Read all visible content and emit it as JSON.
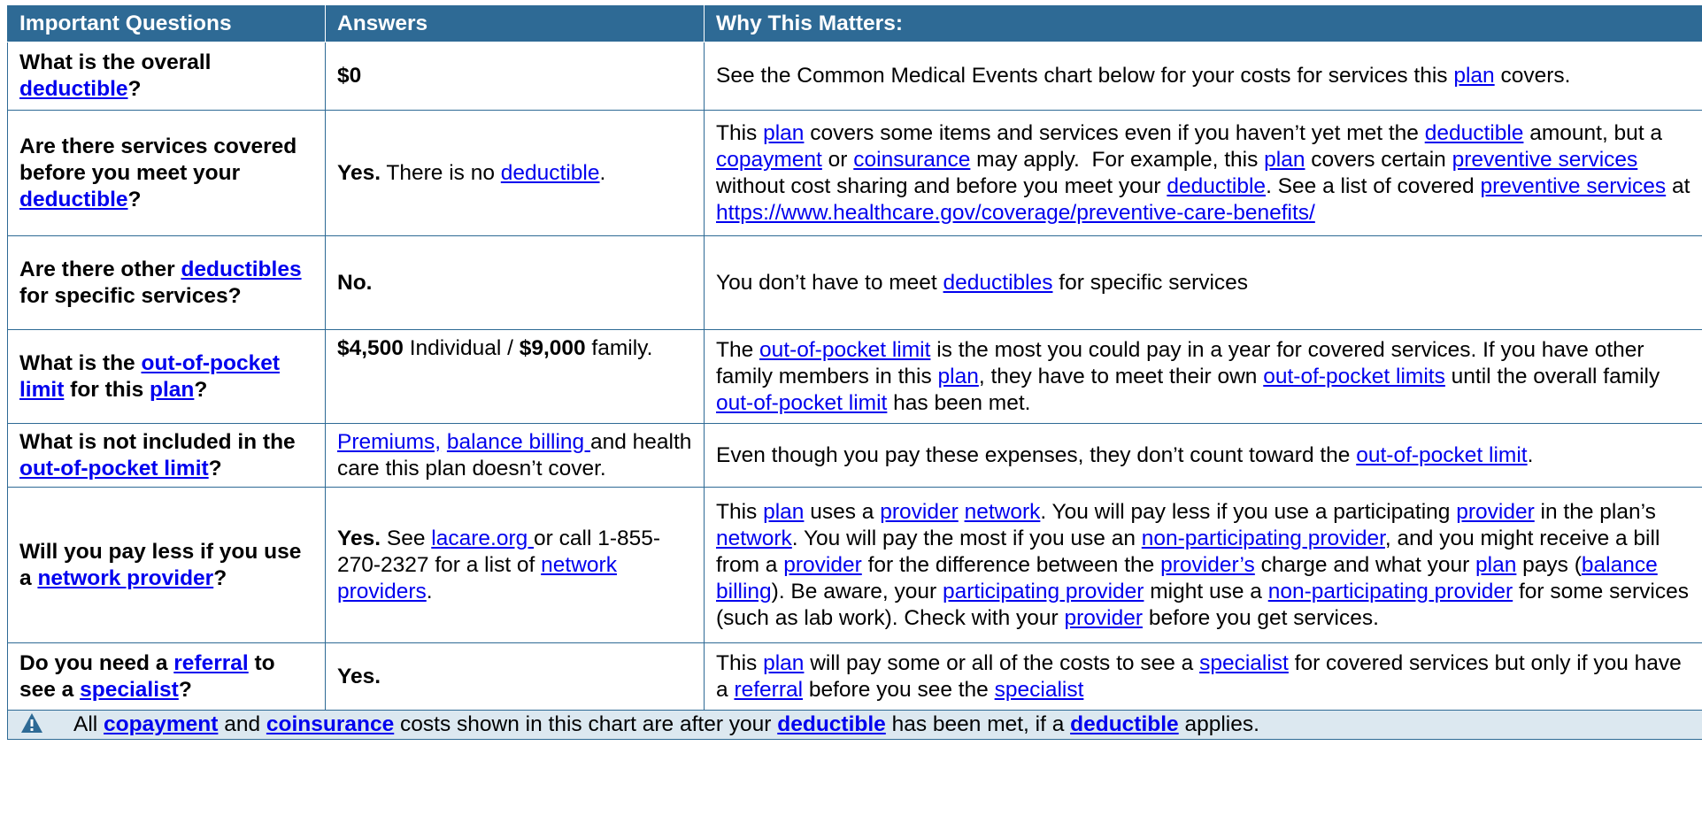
{
  "headers": {
    "questions": "Important Questions",
    "answers": "Answers",
    "why": "Why This Matters:"
  },
  "rows": {
    "r1": {
      "q_pre": "What is the overall ",
      "q_link": "deductible",
      "q_post": "?",
      "answer": "$0",
      "why_pre": "See the Common Medical Events chart below for your costs for services this ",
      "why_link": "plan",
      "why_post": " covers."
    },
    "r2": {
      "q_pre": "Are there services covered before you meet your ",
      "q_link": "deductible",
      "q_post": "?",
      "a_bold": "Yes.",
      "a_text": " There is no ",
      "a_link": "deductible",
      "a_post": ".",
      "w1": "This ",
      "w_plan": "plan",
      "w2": " covers some items and services even if you haven’t yet met the ",
      "w_deductible": "deductible",
      "w3": " amount, but a ",
      "w_copayment": "copayment",
      "w4": " or ",
      "w_coinsurance": "coinsurance",
      "w5": " may apply.  For example, this ",
      "w_plan2": "plan",
      "w6": " covers certain ",
      "w_preventive": "preventive services",
      "w7": " without cost sharing and before you meet your ",
      "w_deductible2": "deductible",
      "w8": ". See a list of covered ",
      "w_preventive2": "preventive services",
      "w9": " at ",
      "w_url": "https://www.healthcare.gov/coverage/preventive-care-benefits/"
    },
    "r3": {
      "q_pre": "Are there other ",
      "q_link": "deductibles",
      "q_post": " for specific services?",
      "answer": "No.",
      "why_pre": "You don’t have to meet ",
      "why_link": "deductibles",
      "why_post": " for specific services"
    },
    "r4": {
      "q_pre": "What is the ",
      "q_link": "out-of-pocket limit",
      "q_mid": " for this ",
      "q_link2": "plan",
      "q_post": "?",
      "a_b1": "$4,500",
      "a_t1": " Individual / ",
      "a_b2": "$9,000",
      "a_t2": " family.",
      "w1": "The ",
      "w_oop": "out-of-pocket limit",
      "w2": " is the most you could pay in a year for covered services. If you have other family members in this ",
      "w_plan": "plan",
      "w3": ", they have to meet their own ",
      "w_oops": "out-of-pocket limits",
      "w4": " until the overall family ",
      "w_oop2": "out-of-pocket limit",
      "w5": " has been met."
    },
    "r5": {
      "q_pre": "What is not included in the ",
      "q_link": "out-of-pocket limit",
      "q_post": "?",
      "a_link1": "Premiums,",
      "a_sp": " ",
      "a_link2": "balance billing ",
      "a_text": "and health care this plan doesn’t cover.",
      "why_pre": "Even though you pay these expenses, they don’t count toward the ",
      "why_link": "out-of-pocket limit",
      "why_post": "."
    },
    "r6": {
      "q_pre": "Will you pay less if you use a ",
      "q_link": "network provider",
      "q_post": "?",
      "a_bold": "Yes.",
      "a_t1": " See ",
      "a_link1": "lacare.org ",
      "a_t2": " or call 1-855-270-2327 for a list of ",
      "a_link2": "network providers",
      "a_t3": ".",
      "w1": "This ",
      "w_plan": "plan",
      "w2": " uses a ",
      "w_provider": "provider",
      "w3": " ",
      "w_network": "network",
      "w4": ". You will pay less if you use a participating ",
      "w_provider2": "provider",
      "w5": " in the plan’s ",
      "w_network2": "network",
      "w6": ". You will pay the most if you use an ",
      "w_nonpart": "non-participating provider",
      "w7": ", and you might receive a bill from a ",
      "w_provider3": "provider",
      "w8": " for the difference between the ",
      "w_providers": "provider’s",
      "w9": " charge and what your ",
      "w_plan2": "plan",
      "w10": " pays (",
      "w_balance": "balance billing",
      "w11": "). Be aware, your ",
      "w_partprov": "participating provider",
      "w12": " might use a ",
      "w_nonpart2": "non-participating provider",
      "w13": " for some services (such as lab work). Check with your ",
      "w_provider4": "provider",
      "w14": " before you get services."
    },
    "r7": {
      "q_pre": "Do you need a ",
      "q_link": "referral",
      "q_mid": " to see a ",
      "q_link2": "specialist",
      "q_post": "?",
      "answer": "Yes.",
      "w1": "This ",
      "w_plan": "plan",
      "w2": " will pay some or all of the costs to see a ",
      "w_specialist": "specialist",
      "w3": " for covered services but only if you have a ",
      "w_referral": "referral",
      "w4": " before you see the ",
      "w_specialist2": "specialist"
    }
  },
  "note": {
    "icon": "warning-icon",
    "t1": "All ",
    "copayment": "copayment",
    "t2": " and ",
    "coinsurance": "coinsurance",
    "t3": " costs shown in this chart are after your ",
    "deductible": "deductible",
    "t4": " has been met, if a ",
    "deductible2": "deductible",
    "t5": " applies."
  },
  "colors": {
    "header_bg": "#2e6a95",
    "link": "#0000ee",
    "note_bg": "#dce8f0"
  }
}
